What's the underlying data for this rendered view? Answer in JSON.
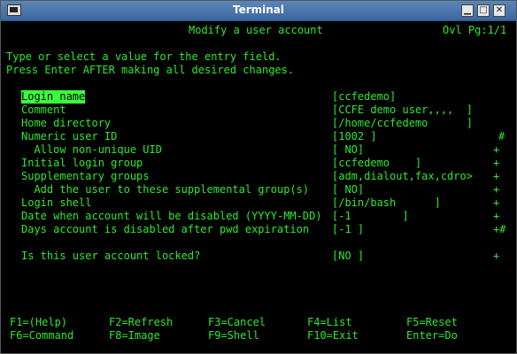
{
  "window": {
    "title": "Terminal"
  },
  "screen": {
    "header_title": "Modify a user account",
    "header_right": "Ovl Pg:1/1",
    "instructions": [
      "Type or select a value for the entry field.",
      "Press Enter AFTER making all desired changes."
    ],
    "fields": [
      {
        "label": "Login name",
        "value": "[ccfedemo]",
        "mark": ""
      },
      {
        "label": "Comment",
        "value": "[CCFE demo user,,,,  ]",
        "mark": ""
      },
      {
        "label": "Home directory",
        "value": "[/home/ccfedemo      ]",
        "mark": ""
      },
      {
        "label": "Numeric user ID",
        "value": "[1002 ]",
        "mark": "#"
      },
      {
        "label": "  Allow non-unique UID",
        "value": "[ NO]",
        "mark": "+"
      },
      {
        "label": "Initial login group",
        "value": "[ccfedemo    ]",
        "mark": "+"
      },
      {
        "label": "Supplementary groups",
        "value": "[adm,dialout,fax,cdro>",
        "mark": "+"
      },
      {
        "label": "  Add the user to these supplemental group(s)",
        "value": "[ NO]",
        "mark": "+"
      },
      {
        "label": "Login shell",
        "value": "[/bin/bash      ]",
        "mark": "+"
      },
      {
        "label": "Date when account will be disabled (YYYY-MM-DD)",
        "value": "[-1        ]",
        "mark": "+"
      },
      {
        "label": "Days account is disabled after pwd expiration",
        "value": "[-1 ]",
        "mark": "+#"
      },
      {
        "label": "Is this user account locked?",
        "value": "[NO ]",
        "mark": "+"
      }
    ],
    "function_keys": [
      [
        "F1=(Help)",
        "F2=Refresh",
        "F3=Cancel",
        "F4=List",
        "F5=Reset"
      ],
      [
        "F6=Command",
        "F8=Image",
        "F9=Shell",
        "F10=Exit",
        "Enter=Do"
      ]
    ]
  }
}
